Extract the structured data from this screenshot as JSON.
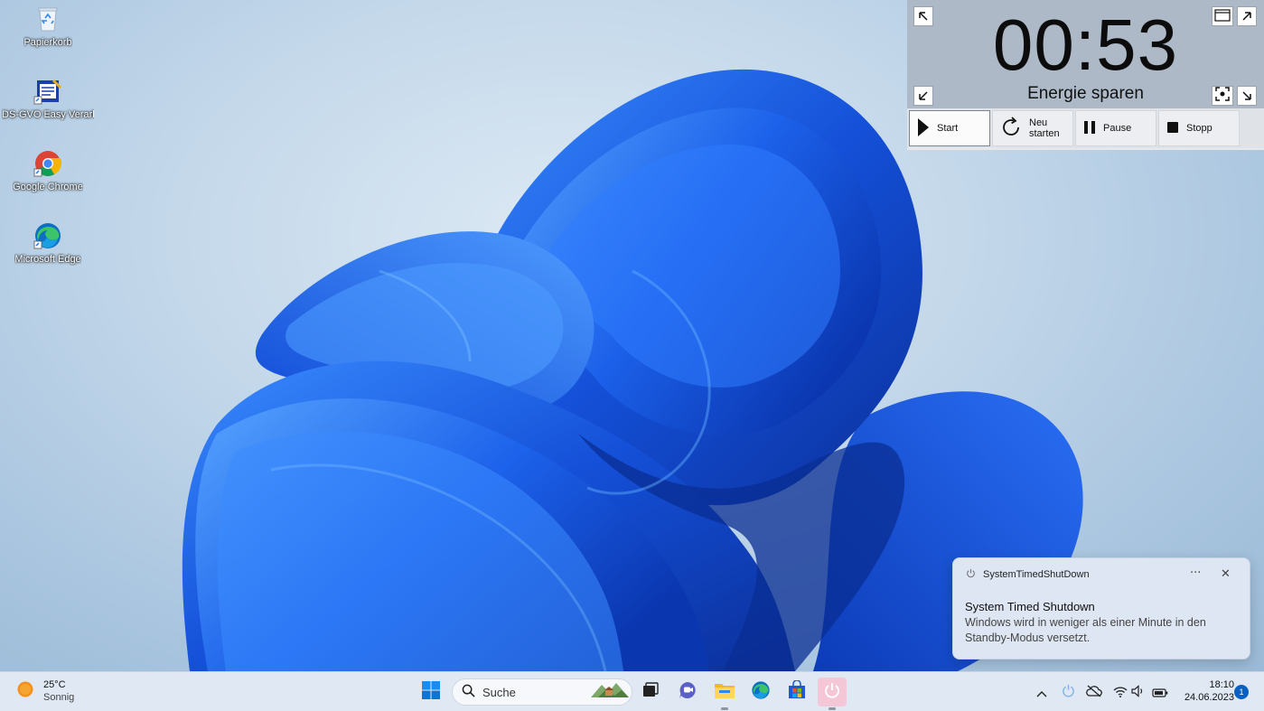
{
  "desktop": {
    "icons": [
      {
        "label": "Papierkorb"
      },
      {
        "label": "DS-GVO Easy Verarbeitungsverze..."
      },
      {
        "label": "Google Chrome"
      },
      {
        "label": "Microsoft Edge"
      }
    ]
  },
  "timer": {
    "display": "00:53",
    "mode": "Energie sparen",
    "buttons": {
      "start": "Start",
      "restart": "Neu starten",
      "pause": "Pause",
      "stop": "Stopp"
    }
  },
  "notification": {
    "app": "SystemTimedShutDown",
    "more": "···",
    "close": "✕",
    "title": "System Timed Shutdown",
    "body": "Windows wird in weniger als einer Minute in den Standby-Modus versetzt."
  },
  "taskbar": {
    "weather": {
      "temp": "25°C",
      "condition": "Sonnig"
    },
    "search_placeholder": "Suche",
    "clock": {
      "time": "18:10",
      "date": "24.06.2023"
    },
    "notification_count": "1"
  },
  "colors": {
    "accent": "#0a5fc2",
    "wallpaper_blue": "#1a5fe0",
    "timer_top": "#adb9c7"
  },
  "icons": {
    "taskbar": [
      "windows-start-icon",
      "search-icon",
      "task-view-icon",
      "teams-chat-icon",
      "file-explorer-icon",
      "edge-icon",
      "store-icon",
      "shutdown-timer-icon"
    ],
    "tray": [
      "chevron-up-icon",
      "power-icon",
      "cloud-offline-icon",
      "wifi-icon",
      "speaker-icon",
      "battery-icon"
    ]
  }
}
